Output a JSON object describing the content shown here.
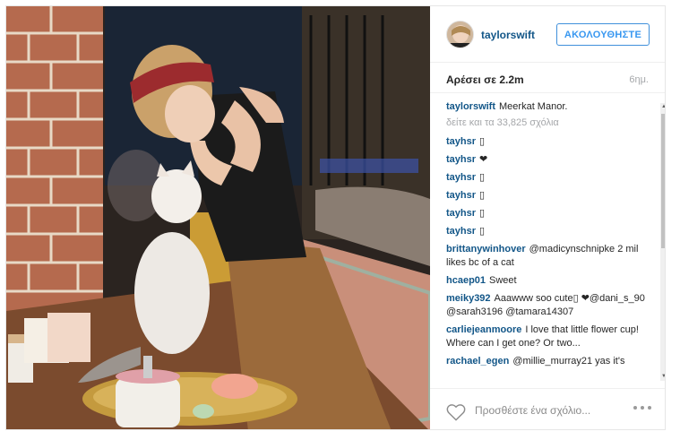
{
  "post": {
    "username": "taylorswift",
    "follow_label": "ΑΚΟΛΟΥΘΗΣΤΕ",
    "likes": "Αρέσει σε 2.2m",
    "time_ago": "6ημ."
  },
  "caption": {
    "author": "taylorswift",
    "text": "Meerkat Manor."
  },
  "view_all_comments": "δείτε και τα 33,825 σχόλια",
  "comments": [
    {
      "author": "tayhsr",
      "text": "▯"
    },
    {
      "author": "tayhsr",
      "text": "❤"
    },
    {
      "author": "tayhsr",
      "text": "▯"
    },
    {
      "author": "tayhsr",
      "text": "▯"
    },
    {
      "author": "tayhsr",
      "text": "▯"
    },
    {
      "author": "tayhsr",
      "text": "▯"
    },
    {
      "author": "brittanywinhover",
      "text": "@madicynschnipke 2 mil likes bc of a cat"
    },
    {
      "author": "hcaep01",
      "text": "Sweet"
    },
    {
      "author": "meiky392",
      "text": "Aaawww soo cute▯ ❤@dani_s_90 @sarah3196 @tamara14307"
    },
    {
      "author": "carliejeanmoore",
      "text": "I love that little flower cup! Where can I get one? Or two..."
    },
    {
      "author": "rachael_egen",
      "text": "@millie_murray21 yas it's"
    }
  ],
  "footer": {
    "comment_placeholder": "Προσθέστε ένα σχόλιο...",
    "heart_icon": "heart-outline-icon",
    "more_icon": "more-options-icon"
  },
  "colors": {
    "link": "#125688",
    "follow": "#3897f0",
    "muted": "#a5a7aa"
  }
}
